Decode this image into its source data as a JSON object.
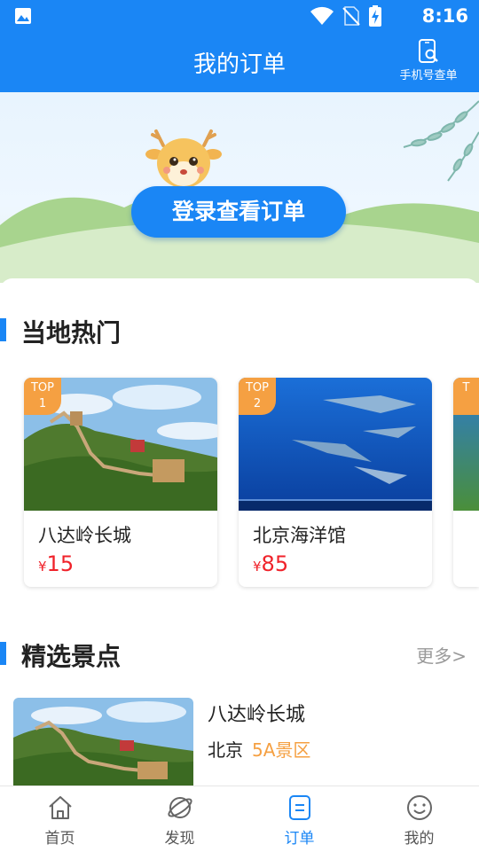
{
  "status_bar": {
    "time": "8:16",
    "icons": [
      "image-icon",
      "wifi-icon",
      "no-sim-icon",
      "battery-charging-icon"
    ]
  },
  "header": {
    "title": "我的订单",
    "phone_query_label": "手机号查单"
  },
  "banner": {
    "login_button": "登录查看订单"
  },
  "local_hot": {
    "title": "当地热门",
    "items": [
      {
        "badge_top": "TOP",
        "badge_rank": "1",
        "name": "八达岭长城",
        "currency": "¥",
        "price": "15"
      },
      {
        "badge_top": "TOP",
        "badge_rank": "2",
        "name": "北京海洋馆",
        "currency": "¥",
        "price": "85"
      },
      {
        "badge_top": "T",
        "badge_rank": "",
        "name": "",
        "currency": "",
        "price": ""
      }
    ]
  },
  "featured": {
    "title": "精选景点",
    "more_label": "更多>",
    "items": [
      {
        "name": "八达岭长城",
        "city": "北京",
        "level": "5A景区"
      }
    ]
  },
  "tabbar": {
    "tabs": [
      {
        "label": "首页",
        "icon": "home-icon"
      },
      {
        "label": "发现",
        "icon": "planet-icon"
      },
      {
        "label": "订单",
        "icon": "order-icon",
        "active": true
      },
      {
        "label": "我的",
        "icon": "smile-icon"
      }
    ]
  },
  "colors": {
    "primary": "#1a86f5",
    "accent": "#f5a042",
    "price": "#f0222a"
  }
}
